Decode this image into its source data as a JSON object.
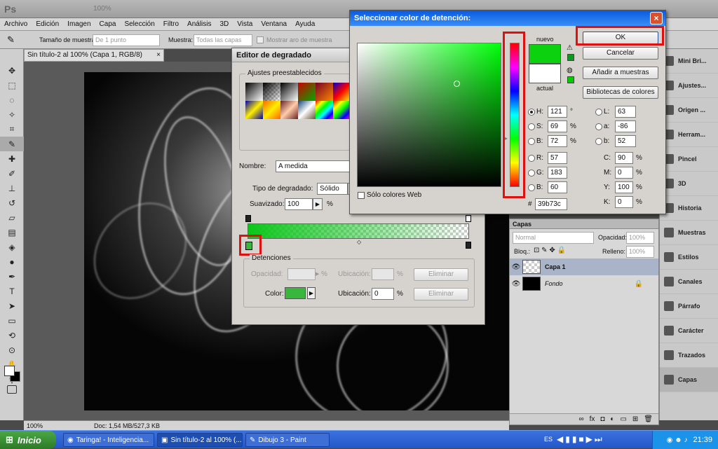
{
  "app": {
    "logo": "Ps",
    "zoom": "100%"
  },
  "menu": [
    "Archivo",
    "Edición",
    "Imagen",
    "Capa",
    "Selección",
    "Filtro",
    "Análisis",
    "3D",
    "Vista",
    "Ventana",
    "Ayuda"
  ],
  "options": {
    "sample_size_label": "Tamaño de muestra:",
    "sample_size_value": "De 1 punto",
    "sample_label": "Muestra:",
    "sample_value": "Todas las capas",
    "ring_label": "Mostrar aro de muestra"
  },
  "document": {
    "tab": "Sin título-2 al 100% (Capa 1, RGB/8)",
    "close": "×",
    "status_zoom": "100%",
    "status_doc": "Doc: 1,54 MB/527,3 KB"
  },
  "dock": [
    "Mini Bri...",
    "Ajustes...",
    "Origen ...",
    "Herram...",
    "Pincel",
    "3D",
    "Historia",
    "Muestras",
    "Estilos",
    "Canales",
    "Párrafo",
    "Carácter",
    "Trazados",
    "Capas"
  ],
  "layers_panel": {
    "title": "Capas",
    "mode": "Normal",
    "opacity_label": "Opacidad:",
    "opacity_value": "100%",
    "lock_label": "Bloq.:",
    "fill_label": "Relleno:",
    "fill_value": "100%",
    "layers": [
      {
        "name": "Capa 1",
        "selected": true
      },
      {
        "name": "Fondo",
        "selected": false
      }
    ]
  },
  "gradient_editor": {
    "title": "Editor de degradado",
    "presets_label": "Ajustes preestablecidos",
    "name_label": "Nombre:",
    "name_value": "A medida",
    "type_label": "Tipo de degradado:",
    "type_value": "Sólido",
    "smooth_label": "Suavizado:",
    "smooth_value": "100",
    "smooth_unit": "%",
    "stops_label": "Detenciones",
    "opacity_label": "Opacidad:",
    "location_label": "Ubicación:",
    "percent": "%",
    "delete_label": "Eliminar",
    "color_label": "Color:",
    "color_location_value": "0",
    "stop_color": "#39b73c"
  },
  "color_picker": {
    "title": "Seleccionar color de detención:",
    "close": "×",
    "new_label": "nuevo",
    "current_label": "actual",
    "ok": "OK",
    "cancel": "Cancelar",
    "add_swatch": "Añadir a muestras",
    "libraries": "Bibliotecas de colores",
    "web_only": "Sólo colores Web",
    "H": {
      "label": "H:",
      "value": "121",
      "unit": "°"
    },
    "S": {
      "label": "S:",
      "value": "69",
      "unit": "%"
    },
    "B": {
      "label": "B:",
      "value": "72",
      "unit": "%"
    },
    "R": {
      "label": "R:",
      "value": "57"
    },
    "G": {
      "label": "G:",
      "value": "183"
    },
    "Bb": {
      "label": "B:",
      "value": "60"
    },
    "L": {
      "label": "L:",
      "value": "63"
    },
    "a": {
      "label": "a:",
      "value": "-86"
    },
    "b": {
      "label": "b:",
      "value": "52"
    },
    "C": {
      "label": "C:",
      "value": "90",
      "unit": "%"
    },
    "M": {
      "label": "M:",
      "value": "0",
      "unit": "%"
    },
    "Y": {
      "label": "Y:",
      "value": "100",
      "unit": "%"
    },
    "K": {
      "label": "K:",
      "value": "0",
      "unit": "%"
    },
    "hex_label": "#",
    "hex": "39b73c",
    "new_color": "#0bd10f",
    "current_color": "#ffffff"
  },
  "taskbar": {
    "start": "Inicio",
    "tasks": [
      "Taringa! - Inteligencia...",
      "Sin título-2 al 100% (...",
      "Dibujo 3 - Paint"
    ],
    "lang": "ES",
    "time": "21:39"
  }
}
